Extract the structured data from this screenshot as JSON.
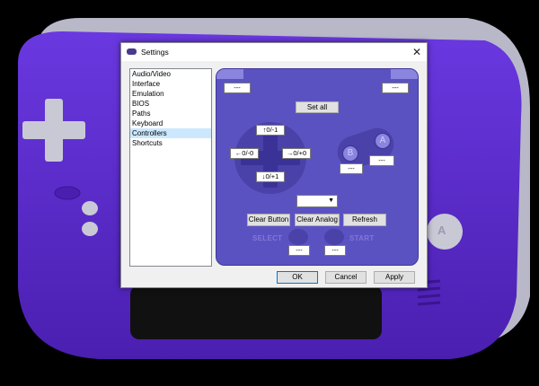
{
  "window": {
    "title": "Settings",
    "close": "✕"
  },
  "nav": {
    "items": [
      {
        "label": "Audio/Video"
      },
      {
        "label": "Interface"
      },
      {
        "label": "Emulation"
      },
      {
        "label": "BIOS"
      },
      {
        "label": "Paths"
      },
      {
        "label": "Keyboard"
      },
      {
        "label": "Controllers"
      },
      {
        "label": "Shortcuts"
      }
    ],
    "selected": "Controllers"
  },
  "controller": {
    "l_button": "---",
    "r_button": "---",
    "set_all": "Set all",
    "up": "↑0/-1",
    "left": "←0/-0",
    "right": "→0/+0",
    "down": "↓0/+1",
    "a_face": "A",
    "b_face": "B",
    "a_binding": "---",
    "b_binding": "---",
    "device_select": "",
    "clear_button": "Clear Button",
    "clear_analog": "Clear Analog",
    "refresh": "Refresh",
    "select_label": "SELECT",
    "start_label": "START",
    "select_binding": "---",
    "start_binding": "---"
  },
  "footer": {
    "ok": "OK",
    "cancel": "Cancel",
    "apply": "Apply"
  },
  "colors": {
    "panel": "#5b52c2",
    "device_body": "#5b2bd1",
    "selection": "#cce8ff"
  },
  "background": {
    "device_a_label": "A"
  }
}
